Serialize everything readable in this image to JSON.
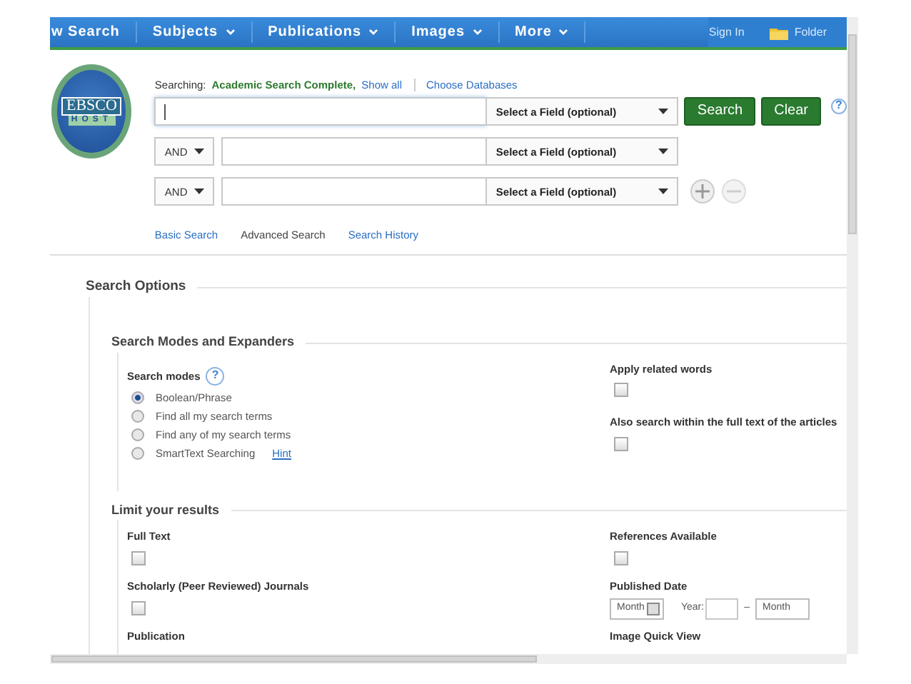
{
  "nav": {
    "items": [
      {
        "label": "w Search",
        "kind": "link"
      },
      {
        "label": "Subjects",
        "kind": "menu"
      },
      {
        "label": "Publications",
        "kind": "menu"
      },
      {
        "label": "Images",
        "kind": "menu"
      },
      {
        "label": "More",
        "kind": "menu"
      }
    ],
    "sign_in": "Sign In",
    "folder": "Folder"
  },
  "logo": {
    "top": "EBSCO",
    "bottom": "HOST"
  },
  "search": {
    "searching_label": "Searching:",
    "database": "Academic Search Complete,",
    "show_all": "Show all",
    "choose": "Choose Databases",
    "rows": [
      {
        "operator": null,
        "field": "Select a Field (optional)",
        "focused": true
      },
      {
        "operator": "AND",
        "field": "Select a Field (optional)",
        "focused": false
      },
      {
        "operator": "AND",
        "field": "Select a Field (optional)",
        "focused": false
      }
    ],
    "buttons": [
      "Search",
      "Clear"
    ],
    "help": "?",
    "links": [
      {
        "label": "Basic Search",
        "selected": false
      },
      {
        "label": "Advanced Search",
        "selected": true
      },
      {
        "label": "Search History",
        "selected": false
      }
    ]
  },
  "options": {
    "title": "Search Options",
    "modes": {
      "title": "Search Modes and Expanders",
      "label": "Search modes",
      "help": "?",
      "radios": [
        {
          "label": "Boolean/Phrase",
          "selected": true
        },
        {
          "label": "Find all my search terms",
          "selected": false
        },
        {
          "label": "Find any of my search terms",
          "selected": false
        },
        {
          "label": "SmartText Searching",
          "selected": false,
          "hint": "Hint"
        }
      ],
      "expanders": [
        {
          "label": "Apply related words",
          "checked": false
        },
        {
          "label": "Also search within the full text of the articles",
          "checked": false
        }
      ]
    },
    "limit": {
      "title": "Limit your results",
      "rows": [
        {
          "left": {
            "kind": "checkbox",
            "label": "Full Text",
            "checked": false
          },
          "right": {
            "kind": "checkbox",
            "label": "References Available",
            "checked": false
          }
        },
        {
          "left": {
            "kind": "checkbox",
            "label": "Scholarly (Peer Reviewed) Journals",
            "checked": false
          },
          "right": {
            "kind": "date",
            "label": "Published Date",
            "month": "Month",
            "year": "Year:",
            "dash": "–",
            "month2": "Month"
          }
        },
        {
          "left": {
            "kind": "heading",
            "label": "Publication"
          },
          "right": {
            "kind": "heading",
            "label": "Image Quick View"
          }
        }
      ]
    }
  }
}
